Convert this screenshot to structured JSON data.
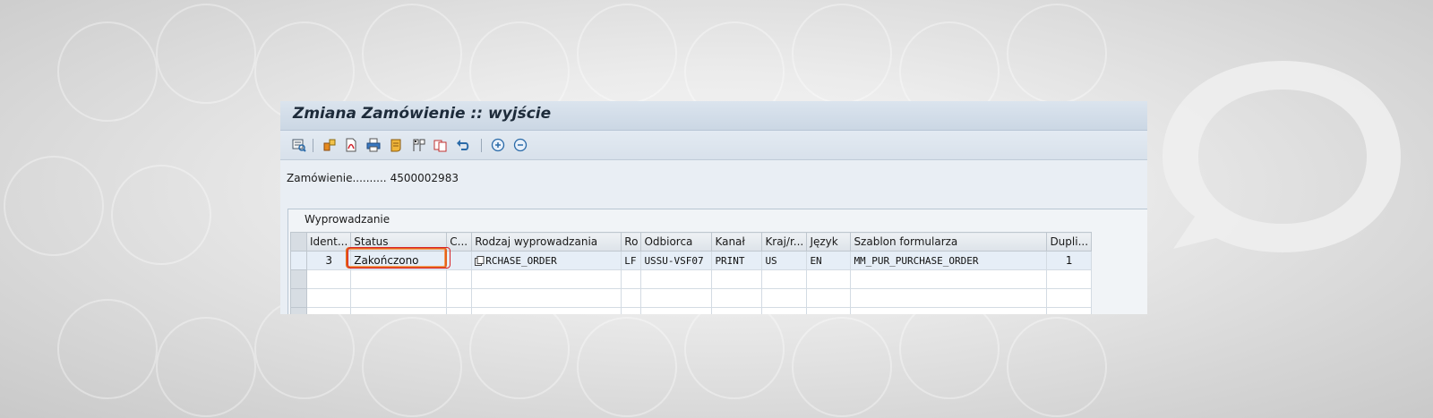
{
  "window": {
    "title": "Zmiana Zamówienie :: wyjście"
  },
  "toolbar": {
    "icons": [
      "display-icon",
      "detail-icon",
      "pdf-icon",
      "print-icon",
      "scroll-icon",
      "flags-icon",
      "copy-icon",
      "undo-icon",
      "zoom-in-icon",
      "zoom-out-icon"
    ]
  },
  "order": {
    "label": "Zamówienie..........",
    "value": "4500002983"
  },
  "panel": {
    "title": "Wyprowadzanie"
  },
  "table": {
    "headers": [
      "Ident...",
      "Status",
      "C...",
      "Rodzaj wyprowadzania",
      "Ro",
      "Odbiorca",
      "Kanał",
      "Kraj/r...",
      "Język",
      "Szablon formularza",
      "Dupli..."
    ],
    "rows": [
      {
        "ident": "3",
        "status": "Zakończono",
        "c": "",
        "rodzaj": "RCHASE_ORDER",
        "ro": "LF",
        "odbiorca": "USSU-VSF07",
        "kanal": "PRINT",
        "kraj": "US",
        "jezyk": "EN",
        "szablon": "MM_PUR_PURCHASE_ORDER",
        "dupli": "1"
      }
    ]
  },
  "colors": {
    "highlight_orange": "#e6621a",
    "highlight_red": "#d7232a",
    "title_bar": "#cbd7e4"
  }
}
